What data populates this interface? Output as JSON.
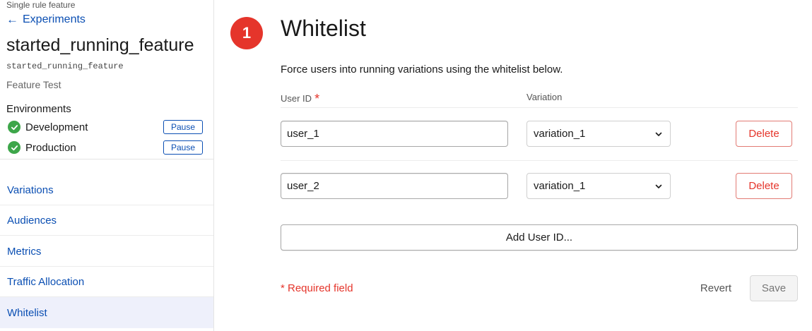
{
  "sidebar": {
    "feature_kind": "Single rule feature",
    "back_label": "Experiments",
    "feature_title": "started_running_feature",
    "feature_key": "started_running_feature",
    "feature_type": "Feature Test",
    "environments_heading": "Environments",
    "environments": [
      {
        "name": "Development",
        "status_icon": "check-circle-icon",
        "action_label": "Pause"
      },
      {
        "name": "Production",
        "status_icon": "check-circle-icon",
        "action_label": "Pause"
      }
    ],
    "nav": [
      {
        "label": "Variations",
        "active": false
      },
      {
        "label": "Audiences",
        "active": false
      },
      {
        "label": "Metrics",
        "active": false
      },
      {
        "label": "Traffic Allocation",
        "active": false
      },
      {
        "label": "Whitelist",
        "active": true
      }
    ]
  },
  "main": {
    "step_number": "1",
    "title": "Whitelist",
    "description": "Force users into running variations using the whitelist below.",
    "columns": {
      "user_id": "User ID",
      "required_marker": "*",
      "variation": "Variation"
    },
    "rows": [
      {
        "user_id": "user_1",
        "variation": "variation_1",
        "delete_label": "Delete"
      },
      {
        "user_id": "user_2",
        "variation": "variation_1",
        "delete_label": "Delete"
      }
    ],
    "add_label": "Add User ID...",
    "required_note": "* Required field",
    "revert_label": "Revert",
    "save_label": "Save"
  },
  "colors": {
    "accent_blue": "#0b4fb3",
    "danger_red": "#e5352b",
    "success_green": "#3da64a"
  }
}
